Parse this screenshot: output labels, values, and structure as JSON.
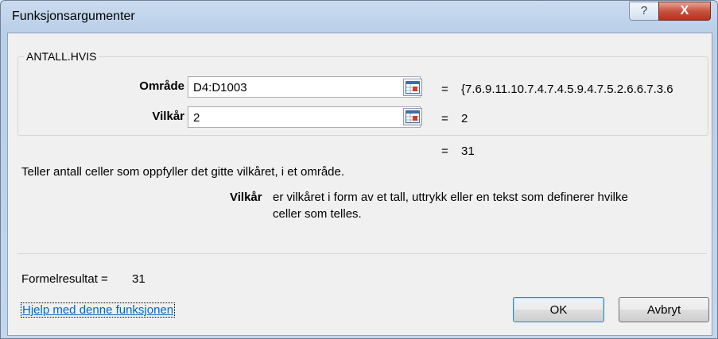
{
  "window": {
    "title": "Funksjonsargumenter",
    "help_glyph": "?",
    "close_glyph": "X"
  },
  "function": {
    "name": "ANTALL.HVIS"
  },
  "arguments": [
    {
      "label": "Område",
      "input_value": "D4:D1003",
      "equals": "=",
      "evaluated": "{7.6.9.11.10.7.4.7.4.5.9.4.7.5.2.6.6.7.3.6"
    },
    {
      "label": "Vilkår",
      "input_value": "2",
      "equals": "=",
      "evaluated": "2"
    }
  ],
  "result": {
    "equals": "=",
    "value": "31"
  },
  "description": "Teller antall celler som oppfyller det gitte vilkåret, i et område.",
  "arg_help": {
    "name": "Vilkår",
    "text_line1": "er vilkåret i form av et tall, uttrykk eller en tekst som definerer hvilke",
    "text_line2": "celler som telles."
  },
  "formula_result": {
    "label": "Formelresultat =",
    "value": "31"
  },
  "help_link": "Hjelp med denne funksjonen",
  "buttons": {
    "ok": "OK",
    "cancel": "Avbryt"
  }
}
